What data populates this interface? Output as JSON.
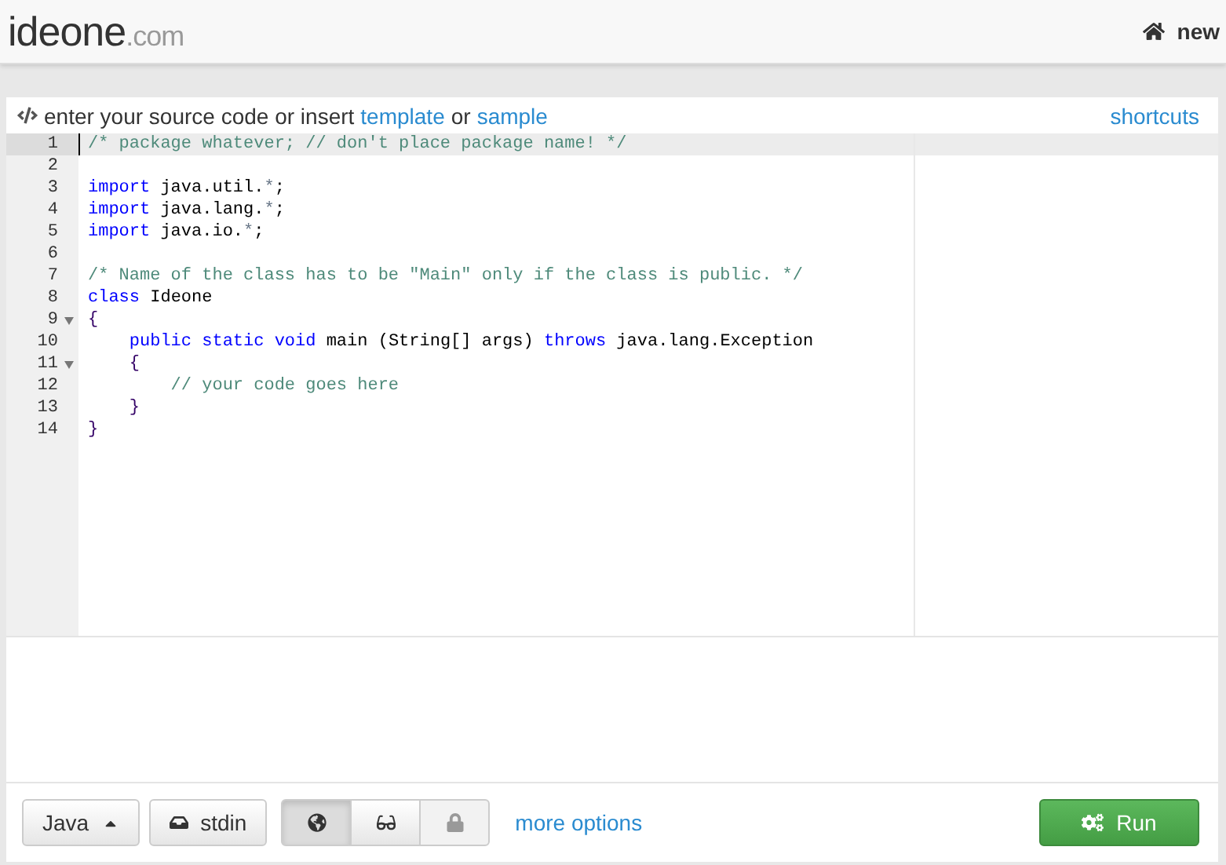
{
  "header": {
    "logo_main": "ideone",
    "logo_suffix": ".com",
    "nav_link": "new"
  },
  "editor_bar": {
    "prompt": "enter your source code or insert",
    "link_1": "template",
    "joiner": "or",
    "link_2": "sample",
    "shortcuts": "shortcuts"
  },
  "code_lines": [
    {
      "number": "1",
      "active": true,
      "foldable": false,
      "tokens": [
        {
          "kind": "comment",
          "text": "/* package whatever; // don't place package name! */"
        }
      ]
    },
    {
      "number": "2",
      "active": false,
      "foldable": false
    },
    {
      "number": "3",
      "active": false,
      "foldable": false,
      "tokens": [
        {
          "kind": "keyword",
          "text": "import"
        },
        {
          "kind": "plain",
          "text": " java.util."
        },
        {
          "kind": "operator",
          "text": "*"
        },
        {
          "kind": "plain",
          "text": ";"
        }
      ]
    },
    {
      "number": "4",
      "active": false,
      "foldable": false,
      "tokens": [
        {
          "kind": "keyword",
          "text": "import"
        },
        {
          "kind": "plain",
          "text": " java.lang."
        },
        {
          "kind": "operator",
          "text": "*"
        },
        {
          "kind": "plain",
          "text": ";"
        }
      ]
    },
    {
      "number": "5",
      "active": false,
      "foldable": false,
      "tokens": [
        {
          "kind": "keyword",
          "text": "import"
        },
        {
          "kind": "plain",
          "text": " java.io."
        },
        {
          "kind": "operator",
          "text": "*"
        },
        {
          "kind": "plain",
          "text": ";"
        }
      ]
    },
    {
      "number": "6",
      "active": false,
      "foldable": false
    },
    {
      "number": "7",
      "active": false,
      "foldable": false,
      "tokens": [
        {
          "kind": "comment",
          "text": "/* Name of the class has to be \"Main\" only if the class is public. */"
        }
      ]
    },
    {
      "number": "8",
      "active": false,
      "foldable": false,
      "tokens": [
        {
          "kind": "keyword",
          "text": "class"
        },
        {
          "kind": "plain",
          "text": " Ideone"
        }
      ]
    },
    {
      "number": "9",
      "active": false,
      "foldable": true,
      "tokens": [
        {
          "kind": "brace",
          "text": "{"
        }
      ]
    },
    {
      "number": "10",
      "active": false,
      "foldable": false,
      "tokens": [
        {
          "kind": "keyword",
          "text": "    public static void"
        },
        {
          "kind": "plain",
          "text": " main (String[] args) "
        },
        {
          "kind": "keyword",
          "text": "throws"
        },
        {
          "kind": "plain",
          "text": " java.lang.Exception"
        }
      ]
    },
    {
      "number": "11",
      "active": false,
      "foldable": true,
      "tokens": [
        {
          "kind": "brace",
          "text": "    {"
        }
      ]
    },
    {
      "number": "12",
      "active": false,
      "foldable": false,
      "tokens": [
        {
          "kind": "comment",
          "text": "        // your code goes here"
        }
      ]
    },
    {
      "number": "13",
      "active": false,
      "foldable": false,
      "tokens": [
        {
          "kind": "brace",
          "text": "    }"
        }
      ]
    },
    {
      "number": "14",
      "active": false,
      "foldable": false,
      "tokens": [
        {
          "kind": "brace",
          "text": "}"
        }
      ]
    }
  ],
  "toolbar": {
    "language": "Java",
    "stdin": "stdin",
    "visibility": [
      {
        "kind": "globe",
        "selected": true,
        "disabled": false
      },
      {
        "kind": "glasses",
        "selected": false,
        "disabled": false
      },
      {
        "kind": "lock",
        "selected": false,
        "disabled": true
      }
    ],
    "more_options": "more options",
    "run": "Run"
  }
}
